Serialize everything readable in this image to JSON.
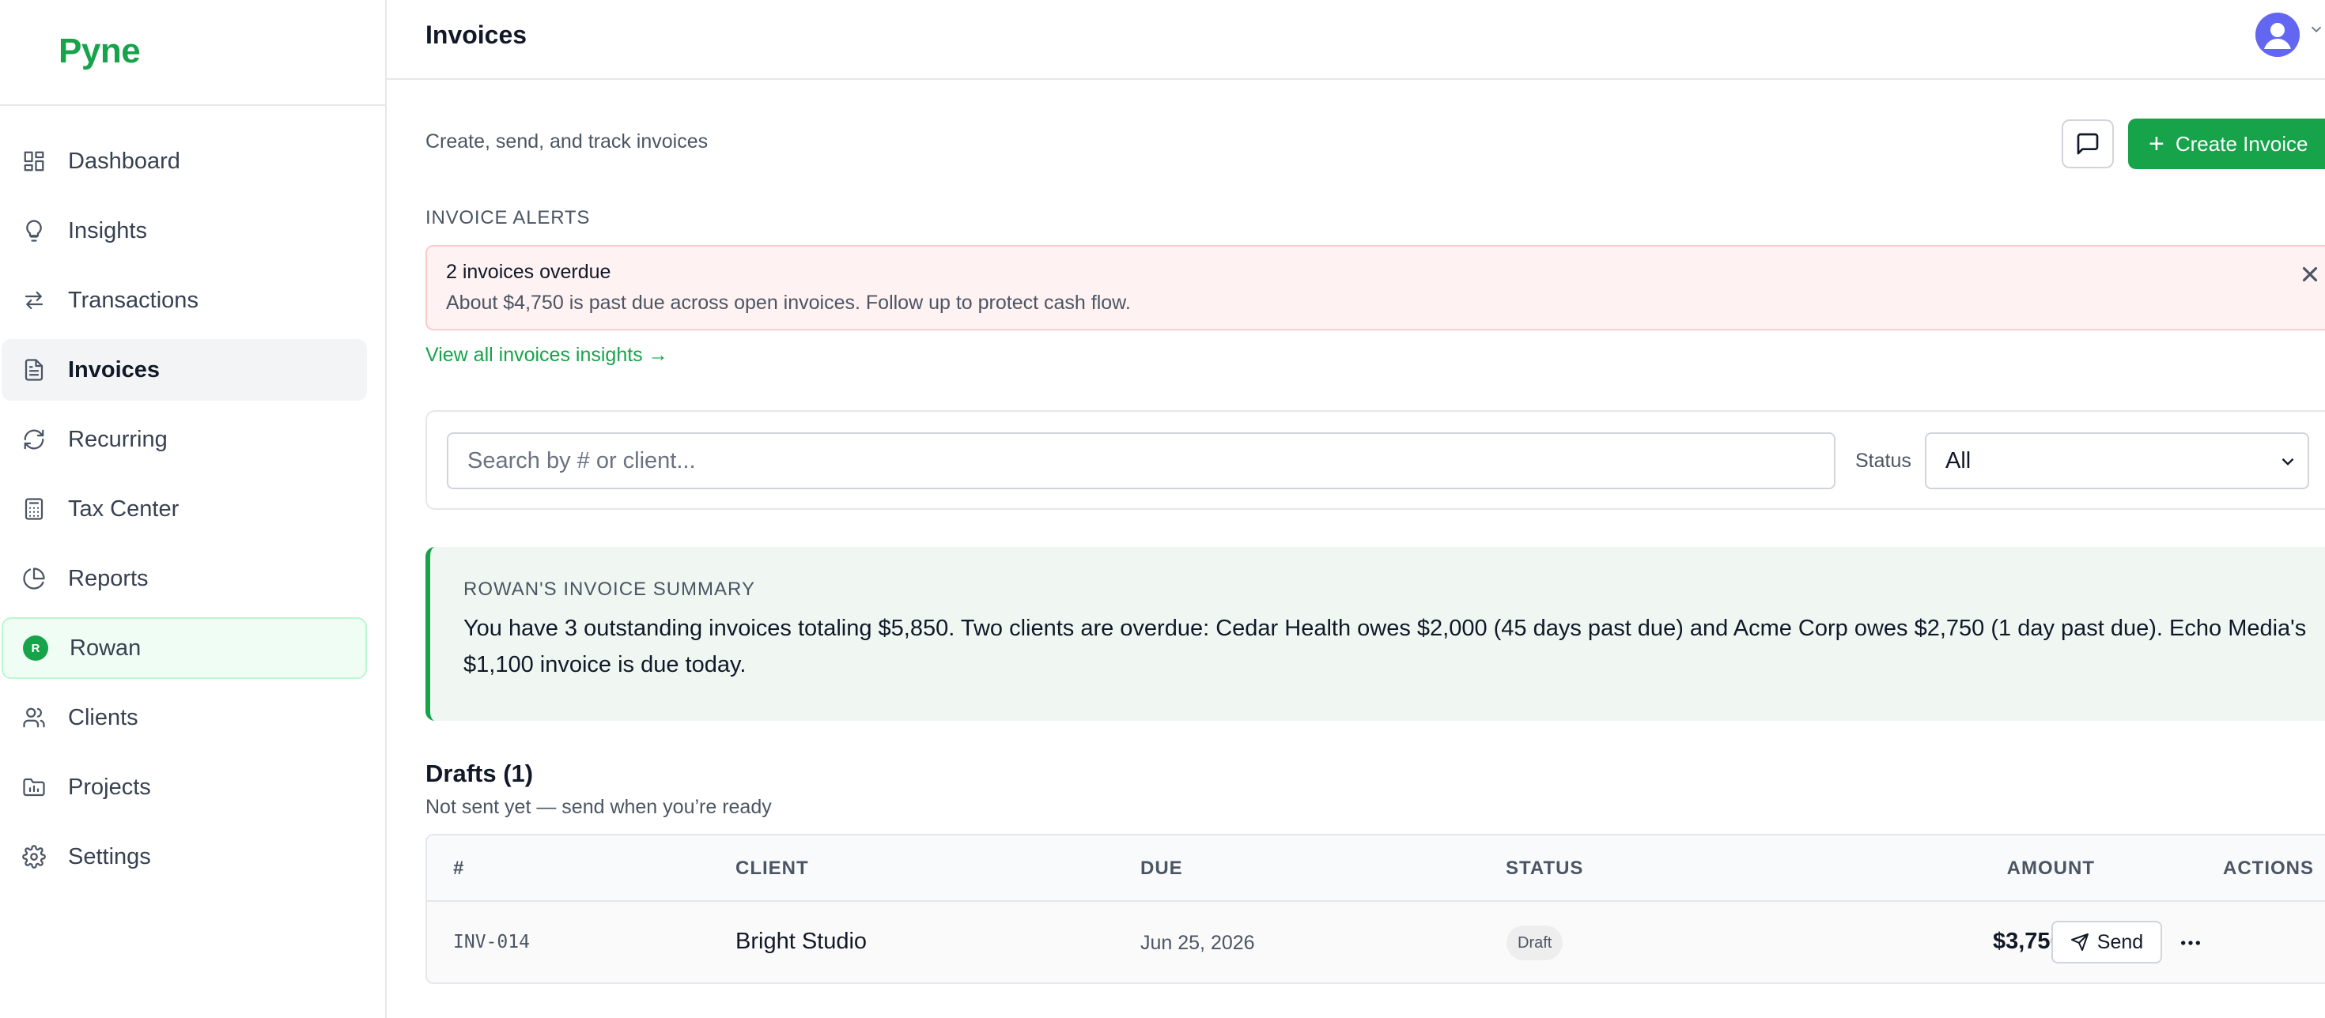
{
  "brand": {
    "name": "Pyne",
    "accent": "#16a34a"
  },
  "sidebar": {
    "items": [
      {
        "label": "Dashboard",
        "icon": "dashboard-icon"
      },
      {
        "label": "Insights",
        "icon": "lightbulb-icon"
      },
      {
        "label": "Transactions",
        "icon": "arrows-swap-icon"
      },
      {
        "label": "Invoices",
        "icon": "document-icon",
        "active": true
      },
      {
        "label": "Recurring",
        "icon": "refresh-icon"
      },
      {
        "label": "Tax Center",
        "icon": "calculator-icon"
      },
      {
        "label": "Reports",
        "icon": "pie-chart-icon"
      },
      {
        "label": "Rowan",
        "icon": "rowan-avatar-icon",
        "avatar_letter": "R"
      },
      {
        "label": "Clients",
        "icon": "users-icon"
      },
      {
        "label": "Projects",
        "icon": "folder-chart-icon"
      },
      {
        "label": "Settings",
        "icon": "gear-icon"
      }
    ]
  },
  "header": {
    "title": "Invoices"
  },
  "main": {
    "subtitle": "Create, send, and track invoices",
    "create_button": "Create Invoice",
    "alerts": {
      "section_label": "INVOICE ALERTS",
      "title": "2 invoices overdue",
      "text": "About $4,750 is past due across open invoices. Follow up to protect cash flow.",
      "link": "View all invoices insights →"
    },
    "filters": {
      "search_placeholder": "Search by # or client...",
      "status_label": "Status",
      "status_value": "All"
    },
    "summary": {
      "label": "ROWAN'S INVOICE SUMMARY",
      "text": "You have 3 outstanding invoices totaling $5,850. Two clients are overdue: Cedar Health owes $2,000 (45 days past due) and Acme Corp owes $2,750 (1 day past due). Echo Media's $1,100 invoice is due today."
    },
    "drafts": {
      "title": "Drafts (1)",
      "subtitle": "Not sent yet — send when you’re ready",
      "columns": [
        "#",
        "CLIENT",
        "DUE",
        "STATUS",
        "AMOUNT",
        "ACTIONS"
      ],
      "rows": [
        {
          "number": "INV-014",
          "client": "Bright Studio",
          "due": "Jun 25, 2026",
          "status": "Draft",
          "amount": "$3,750.00",
          "action": "Send"
        }
      ]
    }
  }
}
